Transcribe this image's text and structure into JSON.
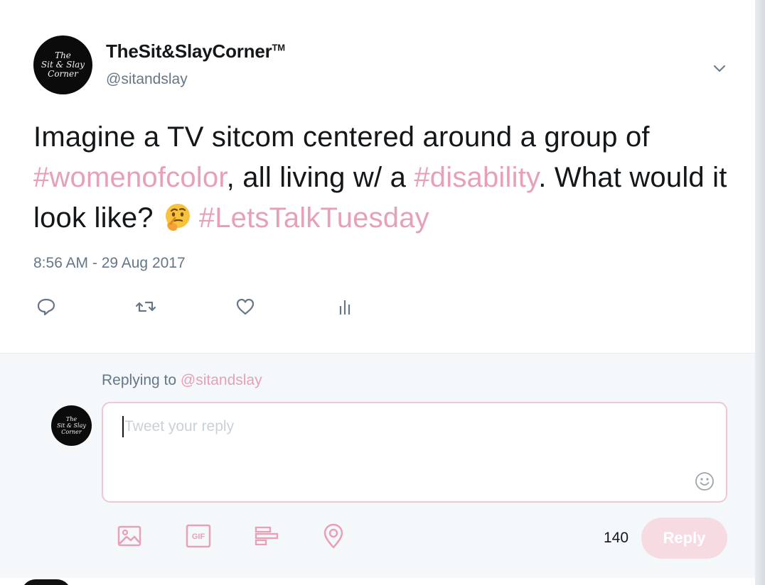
{
  "tweet": {
    "avatar_text": [
      "The",
      "Sit & Slay",
      "Corner"
    ],
    "display_name": "TheSit&SlayCorner",
    "trademark": "TM",
    "handle": "@sitandslay",
    "text_segments": [
      {
        "text": "Imagine a TV sitcom centered around a group of ",
        "type": "text"
      },
      {
        "text": "#womenofcolor",
        "type": "hashtag"
      },
      {
        "text": ", all living w/ a  ",
        "type": "text"
      },
      {
        "text": "#disability",
        "type": "hashtag"
      },
      {
        "text": ". What would it look like?",
        "type": "text"
      },
      {
        "text": "#LetsTalkTuesday",
        "type": "hashtag"
      }
    ],
    "emoji": "thinking-face",
    "timestamp": "8:56 AM - 29 Aug 2017",
    "actions": [
      "reply-icon",
      "retweet-icon",
      "like-icon",
      "analytics-icon"
    ]
  },
  "reply": {
    "replying_to_label": "Replying to",
    "replying_to_handle": "@sitandslay",
    "placeholder": "Tweet your reply",
    "char_count": "140",
    "button_label": "Reply",
    "tools": [
      "image-icon",
      "gif-icon",
      "poll-icon",
      "location-icon"
    ]
  },
  "colors": {
    "accent": "#e7a0b6",
    "text": "#14171a",
    "muted": "#657786",
    "reply_button_bg": "#f6dbe3"
  }
}
